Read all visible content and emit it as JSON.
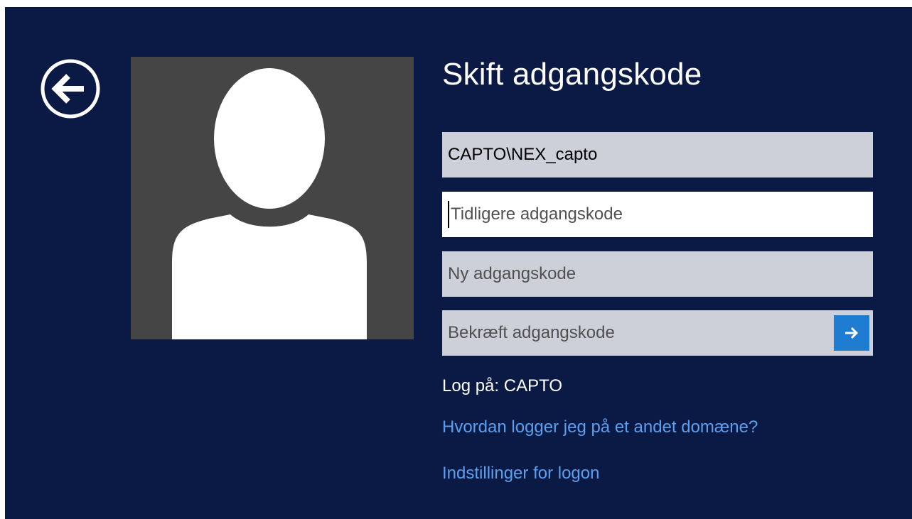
{
  "page": {
    "title": "Skift adgangskode",
    "background_color": "#0b1a45",
    "accent_color": "#1e7cd1",
    "link_color": "#5b9ff0"
  },
  "back_button": {
    "icon": "arrow-left-circle-icon"
  },
  "form": {
    "username": "CAPTO\\NEX_capto",
    "old_password_placeholder": "Tidligere adgangskode",
    "new_password_placeholder": "Ny adgangskode",
    "confirm_password_placeholder": "Bekræft adgangskode",
    "submit_icon": "arrow-right-icon"
  },
  "signin_domain": "Log på: CAPTO",
  "links": {
    "other_domain": "Hvordan logger jeg på et andet domæne?",
    "logon_options": "Indstillinger for logon"
  }
}
